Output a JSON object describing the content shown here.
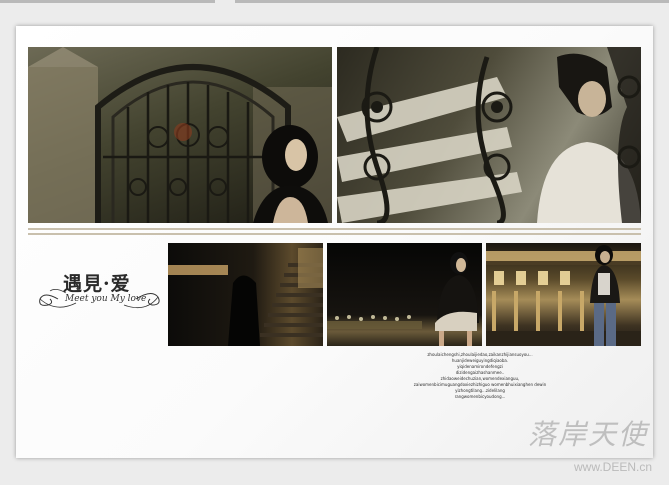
{
  "title": {
    "chinese": "遇見·爱",
    "english": "Meet you My love"
  },
  "text_lines": [
    "zhoulaichengshi,zhoulaijiedao,zaikanzhijiansuoyou...",
    "huanjideweiguyingdiqiaoba.",
    "yiqidenamirondefengzi",
    "dizidengaizhashanmee..",
    "zhidaoweidechuzian,womendexianguu,",
    "zaiwomenbicimuguangdoxiezhizhiguo womenbhuixianghen dewin",
    "yizhongtilang...zidelilang",
    "rangwomenbicyoudong..."
  ],
  "watermark": {
    "text": "落岸天使",
    "url": "www.DEEN.cn"
  },
  "colors": {
    "page": "#ffffff",
    "background": "#ececec",
    "rule": "#c9c0ad",
    "title": "#2a2a2a"
  }
}
